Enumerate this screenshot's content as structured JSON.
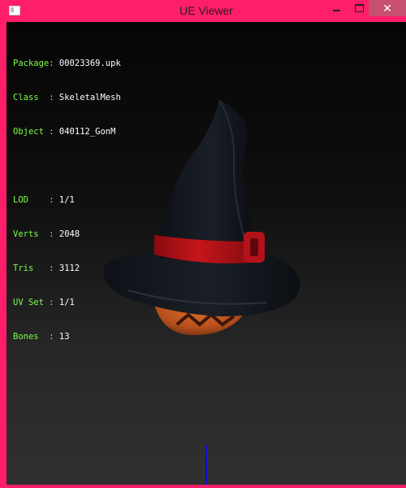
{
  "window": {
    "title": "UE Viewer"
  },
  "info": {
    "package_label": "Package:",
    "package_value": "00023369.upk",
    "class_label": "Class  :",
    "class_value": "SkeletalMesh",
    "object_label": "Object :",
    "object_value": "040112_GonM",
    "lod_label": "LOD    :",
    "lod_value": "1/1",
    "verts_label": "Verts  :",
    "verts_value": "2048",
    "tris_label": "Tris   :",
    "tris_value": "3112",
    "uv_label": "UV Set :",
    "uv_value": "1/1",
    "bones_label": "Bones  :",
    "bones_value": "13"
  },
  "colors": {
    "frame": "#ff1e6a",
    "label_green": "#7cff49",
    "axis_blue": "#1010c7"
  },
  "icons": {
    "app": "app-icon",
    "minimize": "minimize-icon",
    "maximize": "maximize-icon",
    "close": "close-icon"
  }
}
